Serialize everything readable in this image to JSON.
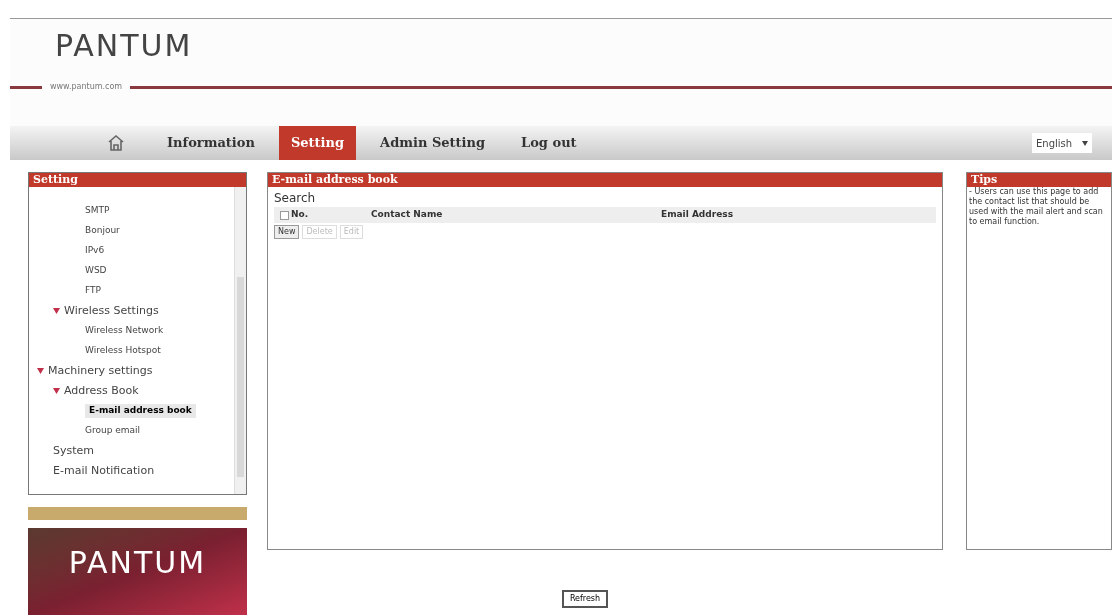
{
  "header": {
    "logo": "PANTUM",
    "url": "www.pantum.com"
  },
  "nav": {
    "tabs": [
      {
        "label": "Information",
        "selected": false
      },
      {
        "label": "Setting",
        "selected": true
      },
      {
        "label": "Admin Setting",
        "selected": false
      },
      {
        "label": "Log out",
        "selected": false
      }
    ],
    "language": "English"
  },
  "sidebar": {
    "title": "Setting",
    "tree": [
      {
        "children": [
          {
            "children": [
              {
                "label": "SMTP",
                "selected": false
              },
              {
                "label": "Bonjour",
                "selected": false
              },
              {
                "label": "IPv6",
                "selected": false
              },
              {
                "label": "WSD",
                "selected": false
              },
              {
                "label": "FTP",
                "selected": false
              }
            ]
          },
          {
            "label": "Wireless Settings",
            "expanded": true,
            "selected": false,
            "children": [
              {
                "label": "Wireless Network",
                "selected": false
              },
              {
                "label": "Wireless Hotspot",
                "selected": false
              }
            ]
          }
        ]
      },
      {
        "label": "Machinery settings",
        "expanded": true,
        "selected": false,
        "children": [
          {
            "label": "Address Book",
            "expanded": true,
            "selected": false,
            "children": [
              {
                "label": "E-mail address book",
                "selected": true
              },
              {
                "label": "Group email",
                "selected": false
              }
            ]
          },
          {
            "label": "System",
            "selected": false
          },
          {
            "label": "E-mail Notification",
            "selected": false
          }
        ]
      }
    ],
    "banner": "PANTUM"
  },
  "main": {
    "title": "E-mail address book",
    "search_label": "Search",
    "table": {
      "select_all": {
        "checked": false
      },
      "columns": [
        "No.",
        "Contact Name",
        "Email Address"
      ]
    },
    "buttons": [
      {
        "label": "New",
        "disabled": false
      },
      {
        "label": "Delete",
        "disabled": true
      },
      {
        "label": "Edit",
        "disabled": true
      }
    ]
  },
  "tips": {
    "title": "Tips",
    "text": "- Users can use this page to add the contact list that should be used with the mail alert and scan to email function."
  },
  "footer": {
    "button": "Refresh"
  }
}
